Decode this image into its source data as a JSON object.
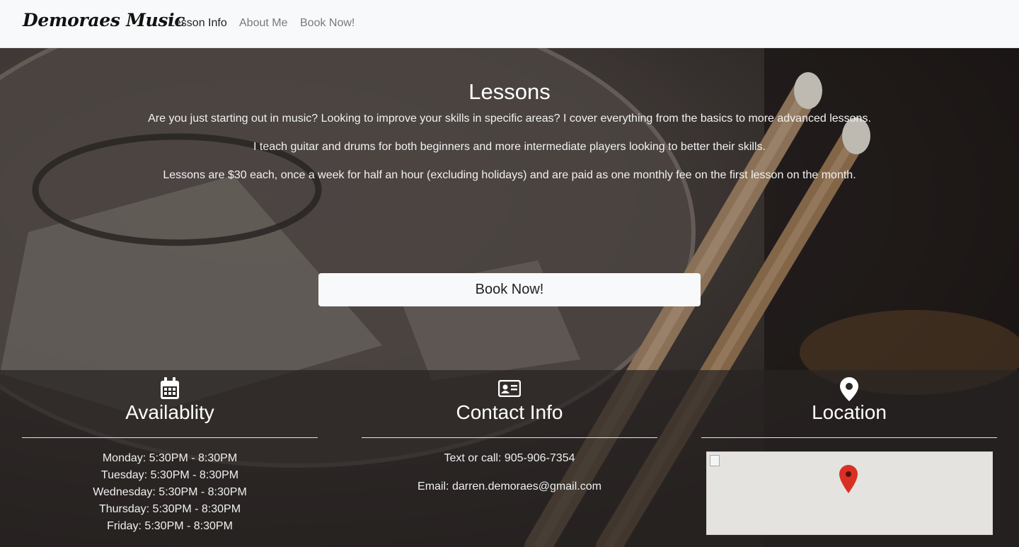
{
  "nav": {
    "brand": "Demoraes Music",
    "links": [
      "Lesson Info",
      "About Me",
      "Book Now!"
    ]
  },
  "hero": {
    "title": "Lessons",
    "paragraphs": [
      "Are you just starting out in music? Looking to improve your skills in specific areas? I cover everything from the basics to more advanced lessons.",
      "I teach guitar and drums for both beginners and more intermediate players looking to better their skills.",
      "Lessons are $30 each, once a week for half an hour (excluding holidays) and are paid as one monthly fee on the first lesson on the month."
    ],
    "button_label": "Book Now!"
  },
  "availability": {
    "icon": "calendar-icon",
    "title": "Availablity",
    "hours": [
      "Monday: 5:30PM - 8:30PM",
      "Tuesday: 5:30PM - 8:30PM",
      "Wednesday: 5:30PM - 8:30PM",
      "Thursday: 5:30PM - 8:30PM",
      "Friday: 5:30PM - 8:30PM"
    ]
  },
  "contact": {
    "icon": "contact-card-icon",
    "title": "Contact Info",
    "phone": "Text or call: 905-906-7354",
    "email": "Email: darren.demoraes@gmail.com"
  },
  "location": {
    "icon": "map-pin-icon",
    "title": "Location"
  },
  "colors": {
    "navbar_bg": "#f8f9fa",
    "button_bg": "#f8f9fa",
    "map_pin": "#d93025"
  }
}
